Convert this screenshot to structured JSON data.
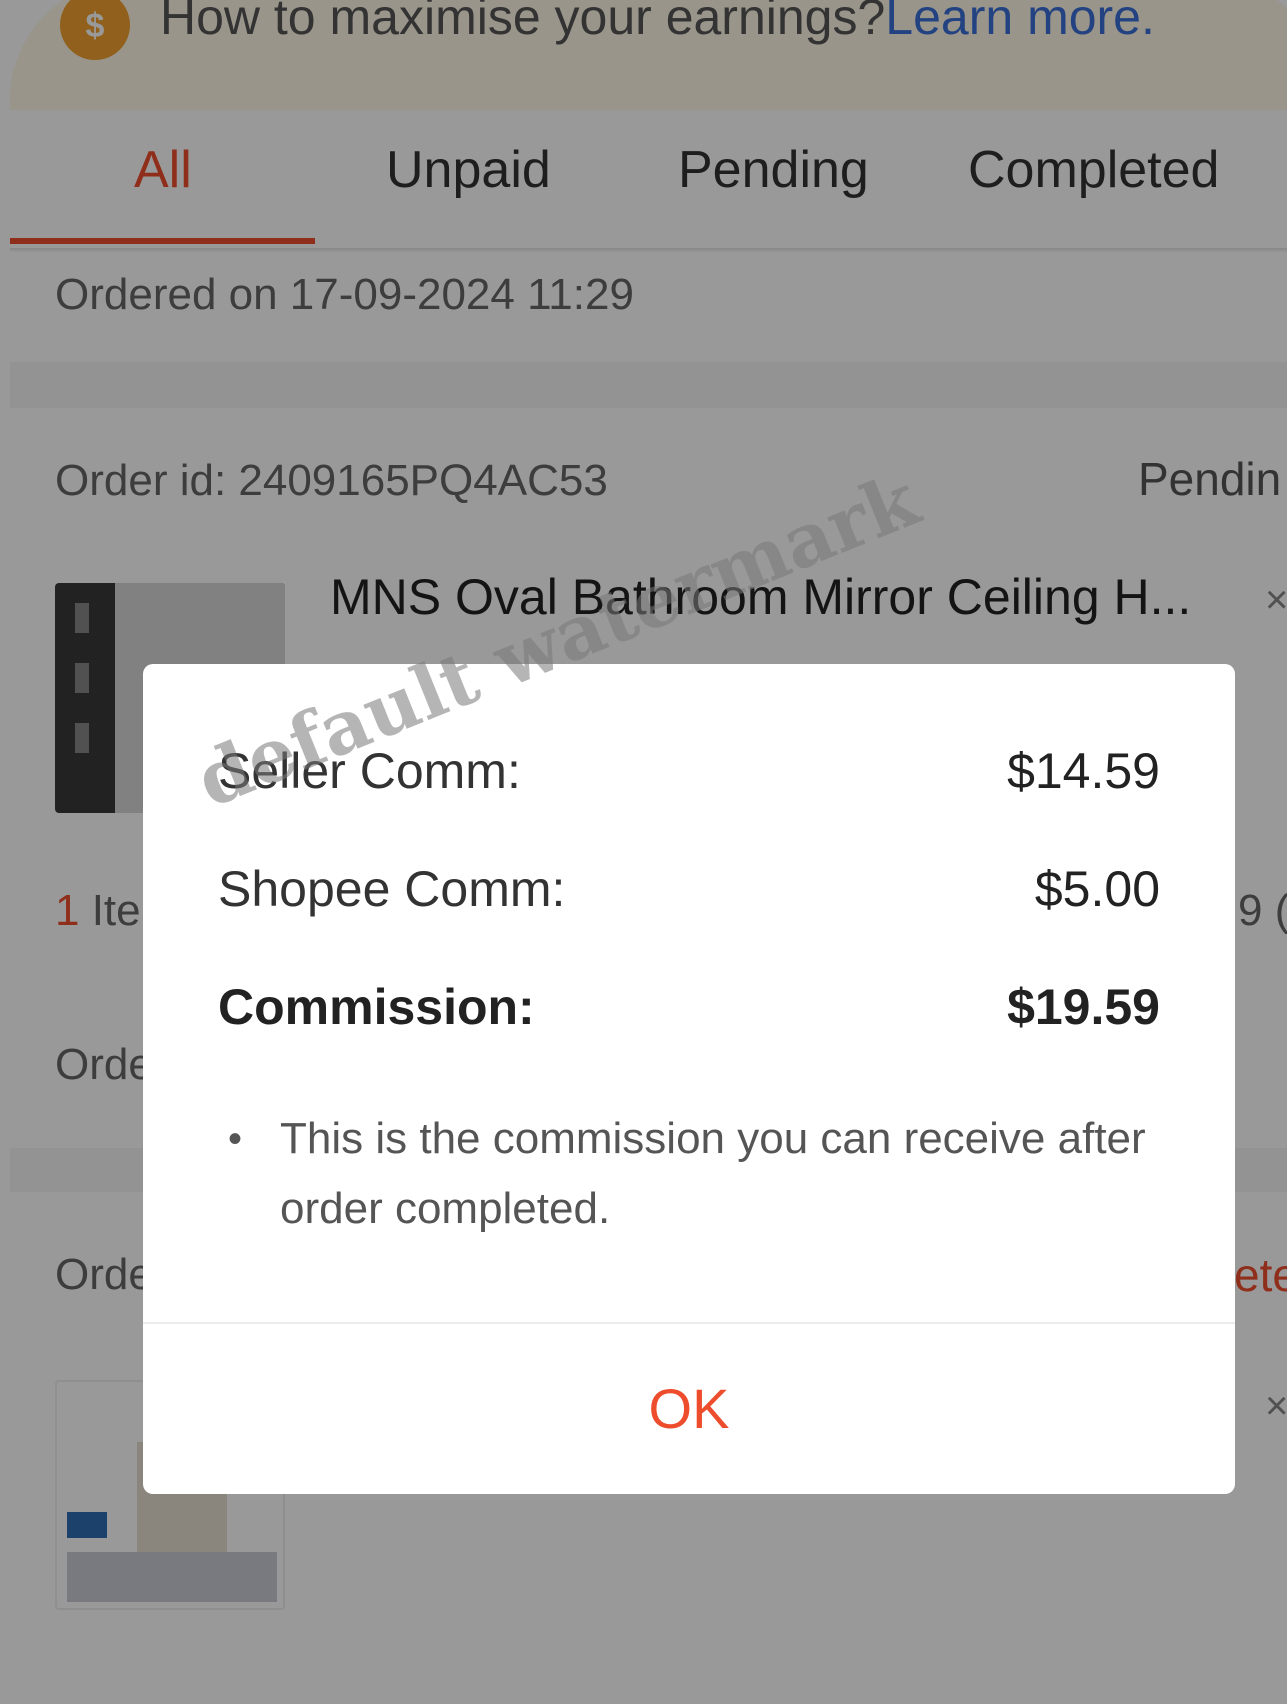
{
  "banner": {
    "text": "How to maximise your earnings?",
    "link": "Learn more."
  },
  "tabs": [
    {
      "label": "All",
      "active": true
    },
    {
      "label": "Unpaid",
      "active": false
    },
    {
      "label": "Pending",
      "active": false
    },
    {
      "label": "Completed",
      "active": false
    }
  ],
  "order_date": "Ordered on 17-09-2024 11:29",
  "orders": [
    {
      "id_label": "Order id: 2409165PQ4AC53",
      "status": "Pendin",
      "product": "MNS Oval Bathroom Mirror Ceiling H...",
      "items_label_count": "1",
      "items_label_rest": " Ite",
      "partial_amount": "9 (",
      "order_label": "Orde"
    },
    {
      "id_label": "Orde",
      "status": "ete"
    }
  ],
  "dialog": {
    "seller_label": "Seller Comm:",
    "seller_value": "$14.59",
    "shopee_label": "Shopee Comm:",
    "shopee_value": "$5.00",
    "total_label": "Commission:",
    "total_value": "$19.59",
    "note": "This is the commission you can receive after order completed.",
    "ok": "OK"
  },
  "watermark": "default watermark",
  "colors": {
    "accent": "#ee4d2d",
    "link": "#3a6fd8"
  }
}
